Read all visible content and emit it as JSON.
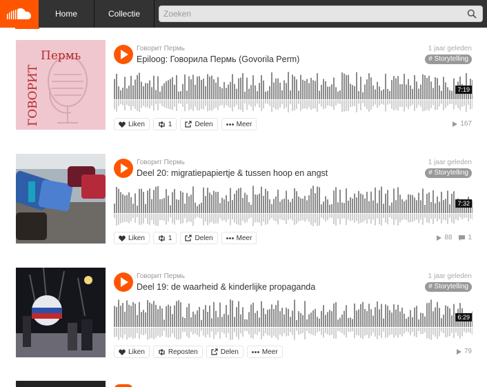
{
  "header": {
    "nav": {
      "home": "Home",
      "collection": "Collectie"
    },
    "search_placeholder": "Zoeken"
  },
  "colors": {
    "accent": "#ff5500",
    "header_bg": "#333333",
    "tag_bg": "#999999"
  },
  "tracks": [
    {
      "user": "Говорит Пермь",
      "title": "Epiloog: Говорила Пермь (Govorila Perm)",
      "date": "1 jaar geleden",
      "tag": "# Storytelling",
      "duration": "7:19",
      "actions": {
        "like": "Liken",
        "repost": "1",
        "share": "Delen",
        "more": "Meer"
      },
      "plays": "167",
      "art_text": {
        "top": "Пермь",
        "side": "ГОВОРИТ"
      }
    },
    {
      "user": "Говорит Пермь",
      "title": "Deel 20: migratiepapiertje & tussen hoop en angst",
      "date": "1 jaar geleden",
      "tag": "# Storytelling",
      "duration": "7:32",
      "actions": {
        "like": "Liken",
        "repost": "1",
        "share": "Delen",
        "more": "Meer"
      },
      "plays": "88",
      "comments": "1"
    },
    {
      "user": "Говорит Пермь",
      "title": "Deel 19: de waarheid & kinderlijke propaganda",
      "date": "1 jaar geleden",
      "tag": "# Storytelling",
      "duration": "6:29",
      "actions": {
        "like": "Liken",
        "repost": "Reposten",
        "share": "Delen",
        "more": "Meer"
      },
      "plays": "79"
    }
  ]
}
